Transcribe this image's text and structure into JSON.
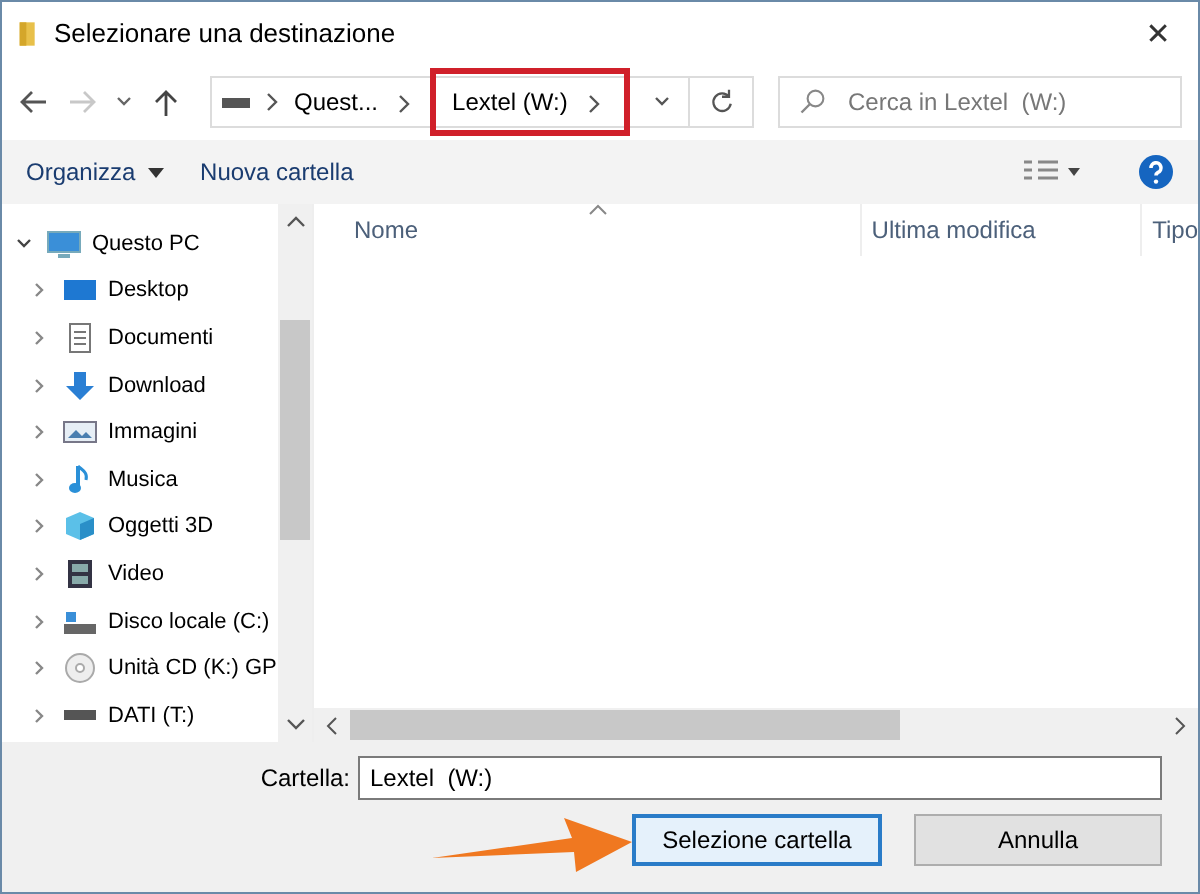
{
  "window": {
    "title": "Selezionare una destinazione",
    "close": "✕"
  },
  "nav": {
    "back_disabled": false,
    "forward_disabled": true,
    "breadcrumb": [
      {
        "label": "Quest...",
        "highlighted": false
      },
      {
        "label": "Lextel  (W:)",
        "highlighted": true
      }
    ],
    "search": {
      "placeholder": "Cerca in Lextel  (W:)"
    }
  },
  "toolbar": {
    "organize": "Organizza",
    "new_folder": "Nuova cartella"
  },
  "sidebar": {
    "items": [
      {
        "label": "Questo PC",
        "kind": "pc",
        "expanded": true,
        "children": [
          {
            "label": "Desktop",
            "kind": "desktop",
            "expanded": false
          },
          {
            "label": "Documenti",
            "kind": "documents",
            "expanded": false
          },
          {
            "label": "Download",
            "kind": "download",
            "expanded": false
          },
          {
            "label": "Immagini",
            "kind": "images",
            "expanded": false
          },
          {
            "label": "Musica",
            "kind": "music",
            "expanded": false
          },
          {
            "label": "Oggetti 3D",
            "kind": "objects3d",
            "expanded": false
          },
          {
            "label": "Video",
            "kind": "video",
            "expanded": false
          },
          {
            "label": "Disco locale (C:)",
            "kind": "disk",
            "expanded": false
          },
          {
            "label": "Unità CD (K:) GP",
            "kind": "cd",
            "expanded": false
          },
          {
            "label": "DATI (T:)",
            "kind": "drive",
            "expanded": false
          }
        ]
      }
    ]
  },
  "table": {
    "columns": [
      "Nome",
      "Ultima modifica",
      "Tipo"
    ]
  },
  "folder_field": {
    "label": "Cartella:",
    "value": "Lextel  (W:)"
  },
  "buttons": [
    {
      "label": "Selezione cartella",
      "kind": "primary",
      "annotated": true
    },
    {
      "label": "Annulla",
      "kind": "normal"
    }
  ]
}
